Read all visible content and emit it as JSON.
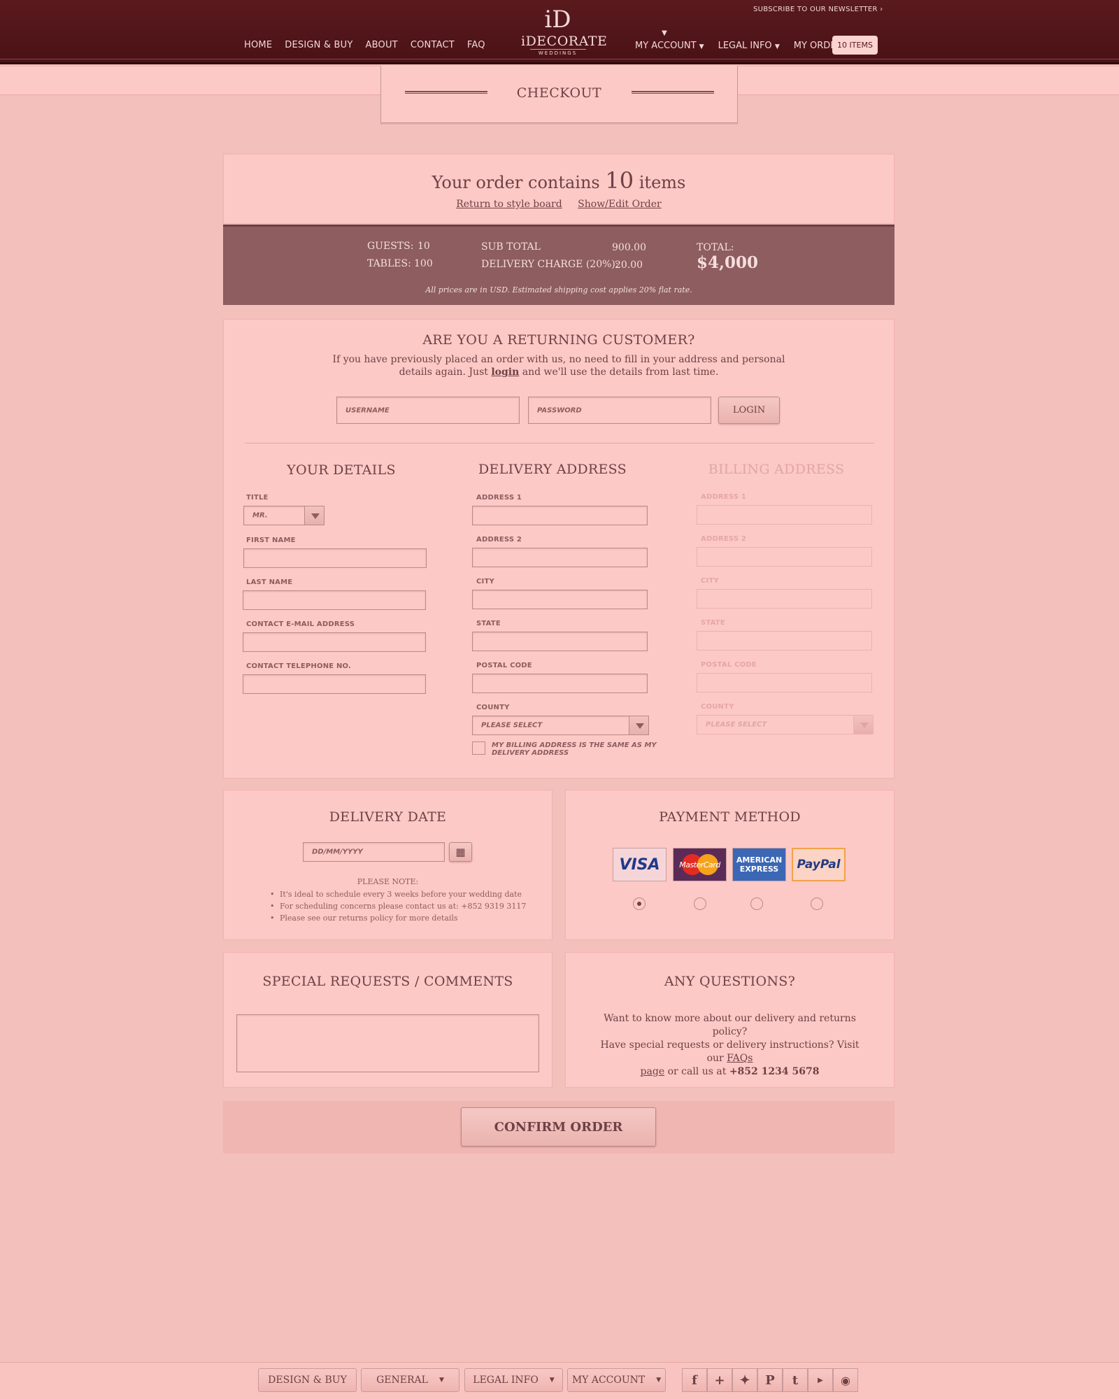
{
  "header": {
    "nav_left": [
      "HOME",
      "DESIGN & BUY",
      "ABOUT",
      "CONTACT",
      "FAQ"
    ],
    "newsletter": "SUBSCRIBE TO OUR  NEWSLETTER",
    "logo_mark": "iD",
    "logo_name": "iDECORATE",
    "logo_sub": "WEDDINGS",
    "my_account": "MY ACCOUNT",
    "legal_info": "LEGAL INFO",
    "my_order": "MY ORDER",
    "order_badge": "10 ITEMS"
  },
  "checkout": {
    "title": "CHECKOUT"
  },
  "order_summary": {
    "prefix": "Your order contains",
    "count": "10",
    "suffix": "items",
    "link_style_board": "Return to style board",
    "link_edit_order": "Show/Edit Order"
  },
  "totals": {
    "guests_label": "GUESTS:",
    "guests_value": "10",
    "tables_label": "TABLES:",
    "tables_value": "100",
    "subtotal_label": "SUB TOTAL",
    "subtotal_value": "900.00",
    "delivery_label": "DELIVERY CHARGE (20%):",
    "delivery_value": "20.00",
    "total_label": "TOTAL:",
    "total_value": "$4,000",
    "note": "All prices are in USD. Estimated shipping cost applies 20% flat rate."
  },
  "returning": {
    "heading": "ARE YOU A RETURNING CUSTOMER?",
    "text1": "If you have previously placed an order with us, no need to fill in your address and personal",
    "text2_pre": "details again. Just",
    "text2_link": "login",
    "text2_post": "and we'll use the details from last time.",
    "username_placeholder": "USERNAME",
    "password_placeholder": "PASSWORD",
    "login_button": "LOGIN"
  },
  "your_details": {
    "heading": "YOUR DETAILS",
    "title_label": "TITLE",
    "title_value": "MR.",
    "first_name_label": "FIRST NAME",
    "last_name_label": "LAST NAME",
    "email_label": "CONTACT E-MAIL ADDRESS",
    "phone_label": "CONTACT TELEPHONE NO."
  },
  "delivery_address": {
    "heading": "DELIVERY ADDRESS",
    "address1": "ADDRESS 1",
    "address2": "ADDRESS 2",
    "city": "CITY",
    "state": "STATE",
    "postal": "POSTAL CODE",
    "county": "COUNTY",
    "county_value": "PLEASE SELECT",
    "same_billing": "MY BILLING ADDRESS IS THE SAME AS MY DELIVERY ADDRESS"
  },
  "billing_address": {
    "heading": "BILLING ADDRESS",
    "address1": "ADDRESS 1",
    "address2": "ADDRESS 2",
    "city": "CITY",
    "state": "STATE",
    "postal": "POSTAL CODE",
    "county": "COUNTY",
    "county_value": "PLEASE SELECT"
  },
  "delivery_date": {
    "heading": "DELIVERY DATE",
    "placeholder": "DD/MM/YYYY",
    "note_heading": "PLEASE NOTE:",
    "notes": [
      "It's ideal to schedule every 3 weeks before your wedding date",
      "For scheduling concerns please contact us at: +852 9319 3117",
      "Please see our returns policy for more details"
    ]
  },
  "payment": {
    "heading": "PAYMENT METHOD",
    "cards": [
      "VISA",
      "MasterCard",
      "AMERICAN EXPRESS",
      "PayPal"
    ],
    "selected_index": 0
  },
  "requests": {
    "heading": "SPECIAL REQUESTS / COMMENTS"
  },
  "questions": {
    "heading": "ANY QUESTIONS?",
    "line1": "Want to know more about our delivery and returns policy?",
    "line2_pre": "Have special requests or delivery instructions? Visit our",
    "line2_link": "FAQs",
    "line3_link": "page",
    "line3_mid": "or call us at",
    "line3_phone": "+852 1234 5678"
  },
  "confirm": {
    "label": "CONFIRM ORDER"
  },
  "footer": {
    "design_buy": "DESIGN & BUY",
    "general": "GENERAL",
    "legal_info": "LEGAL INFO",
    "my_account": "MY ACCOUNT",
    "social_icons": [
      "facebook-icon",
      "plus-icon",
      "twitter-icon",
      "pinterest-icon",
      "tumblr-icon",
      "youtube-icon",
      "instagram-icon"
    ]
  },
  "colors": {
    "header": "#5a1a1e",
    "background": "#f3c0bb",
    "panel": "#fcc9c6",
    "totals_bar": "#8d5d5f",
    "text": "#6e4145"
  }
}
